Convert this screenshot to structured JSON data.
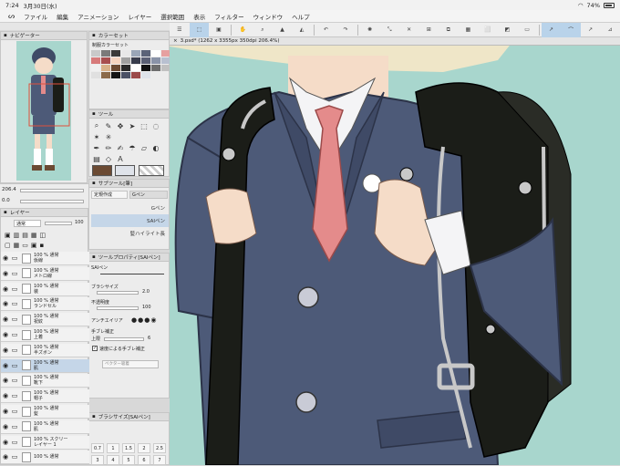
{
  "status": {
    "time": "7:24",
    "date": "3月30日(水)",
    "battery": "74%"
  },
  "menu": [
    "ファイル",
    "編集",
    "アニメーション",
    "レイヤー",
    "選択範囲",
    "表示",
    "フィルター",
    "ウィンドウ",
    "ヘルプ"
  ],
  "panels": {
    "navigator": "ナビゲーター",
    "colorset": "カラーセット",
    "colorset_name": "制服カラーセット",
    "tool": "ツール",
    "subtool": "サブツール[筆]",
    "subtool_tabs": [
      "定規作成",
      "Gペン"
    ],
    "subtool_items": [
      "Gペン",
      "SAIペン",
      "髪ハイライト長"
    ],
    "toolprop": "ツールプロパティ[SAIペン]",
    "toolprop_name": "SAIペン",
    "brushsize": "ブラシサイズ[SAIペン]",
    "layer": "レイヤー"
  },
  "navigator_zoom": "206.4",
  "navigator_angle": "0.0",
  "document_tab": "3.psd* (1262 x 3355px 350dpi 206.4%)",
  "layer_blend": "通常",
  "layer_opacity": "100",
  "layers": [
    {
      "line1": "100 % 通常",
      "line2": "仮線"
    },
    {
      "line1": "100 % 通常",
      "line2": "メトロ線"
    },
    {
      "line1": "100 % 通常",
      "line2": "装"
    },
    {
      "line1": "100 % 通常",
      "line2": "ランドセル"
    },
    {
      "line1": "100 % 通常",
      "line2": "祝紋"
    },
    {
      "line1": "100 % 通常",
      "line2": "上着"
    },
    {
      "line1": "100 % 通常",
      "line2": "半ズボン"
    },
    {
      "line1": "100 % 通常",
      "line2": "肌"
    },
    {
      "line1": "100 % 通常",
      "line2": "靴下"
    },
    {
      "line1": "100 % 通常",
      "line2": "帽子"
    },
    {
      "line1": "100 % 通常",
      "line2": "髪"
    },
    {
      "line1": "100 % 通常",
      "line2": "肌"
    },
    {
      "line1": "100 % スクリー",
      "line2": "レイヤー 1"
    },
    {
      "line1": "100 % 通常",
      "line2": ""
    }
  ],
  "toolprop": {
    "brush_size_label": "ブラシサイズ",
    "brush_size": "2.0",
    "opacity_label": "不透明度",
    "opacity": "100",
    "antialias_label": "アンチエイリア",
    "stabilize_label": "手ブレ補正",
    "stabilize_sub": "上限",
    "stabilize": "6",
    "speed_label": "速度による手ブレ補正",
    "vector_label": "ベクター吸着"
  },
  "brush_sizes": [
    "0.7",
    "1",
    "1.5",
    "2",
    "2.5",
    "3",
    "4",
    "5",
    "6",
    "7"
  ],
  "colors": {
    "swatches": [
      "#c9c9c9",
      "#7a7a7a",
      "#3a3a3a",
      "#e8e8e8",
      "#9aa6b8",
      "#5b6378",
      "#ffffff",
      "#e6a0a0",
      "#d77a7a",
      "#a84e4e",
      "#f4d4c0",
      "#a0a0a0",
      "#383c4c",
      "#5a5f74",
      "#8a93a8",
      "#b8c0d0",
      "#f0f0f0",
      "#d9b28a",
      "#6b4a33",
      "#2a2a2a",
      "#ffffff",
      "#111111",
      "#6d6d6d",
      "#c0c0c0",
      "#e0e0e0",
      "#8b6a4a",
      "#141414",
      "#4b5165",
      "#9b4a4a",
      "#dfe3ea"
    ],
    "canvas_bg": "#a8d6cd",
    "uniform": "#4d5a78",
    "tie": "#e48b8b",
    "bag": "#1b1d18"
  }
}
